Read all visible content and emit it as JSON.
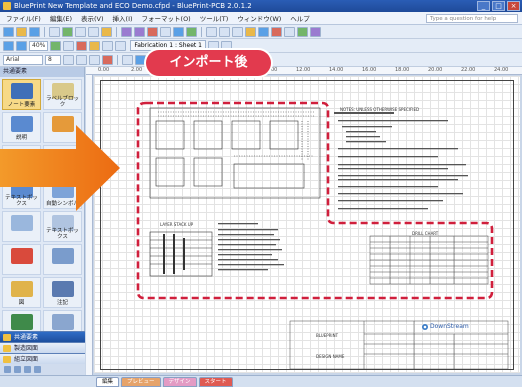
{
  "window": {
    "title": "BluePrint New Template and ECO Demo.cfpd - BluePrint-PCB 2.0.1.2"
  },
  "menu": {
    "items": [
      "ファイル(F)",
      "編集(E)",
      "表示(V)",
      "挿入(I)",
      "フォーマット(O)",
      "ツール(T)",
      "ウィンドウ(W)",
      "ヘルプ"
    ],
    "help_placeholder": "Type a question for help"
  },
  "toolbar": {
    "zoom_value": "40%",
    "font_value": "Arial",
    "size_value": "8",
    "tab_fabrication": "Fabrication 1 : Sheet 1"
  },
  "badge": {
    "label": "インポート後"
  },
  "left_panel": {
    "header": "共通要素",
    "items": [
      {
        "label": "ノート要素",
        "color": "#3f6fb8"
      },
      {
        "label": "ラベルブロック",
        "color": "#d9c98a"
      },
      {
        "label": "説明",
        "color": "#5a8ad0"
      },
      {
        "label": "",
        "color": "#e59a3a"
      },
      {
        "label": "",
        "color": "#6fa0d8"
      },
      {
        "label": "",
        "color": "#c07a3a"
      },
      {
        "label": "テキストボックス",
        "color": "#5a8ad0"
      },
      {
        "label": "自動シンボル",
        "color": "#7da3d8"
      },
      {
        "label": "",
        "color": "#9ab7dd"
      },
      {
        "label": "テキストボックス",
        "color": "#b0c4e0"
      },
      {
        "label": "",
        "color": "#d94a3c"
      },
      {
        "label": "",
        "color": "#7a9ccc"
      },
      {
        "label": "図",
        "color": "#e0b34a"
      },
      {
        "label": "注記",
        "color": "#5a7ab0"
      },
      {
        "label": "",
        "color": "#3f8a4a"
      },
      {
        "label": "詳細",
        "color": "#8aa6cf"
      },
      {
        "label": "拡大図",
        "color": "#e8c060"
      },
      {
        "label": "線",
        "color": "#d8b050"
      }
    ],
    "nav": [
      {
        "label": "共通要素",
        "active": true
      },
      {
        "label": "製造図面",
        "active": false
      },
      {
        "label": "組立図面",
        "active": false
      }
    ]
  },
  "ruler": {
    "labels": [
      "0.00",
      "2.00",
      "4.00",
      "6.00",
      "8.00",
      "10.00",
      "12.00",
      "14.00",
      "16.00",
      "18.00",
      "20.00",
      "22.00",
      "24.00"
    ]
  },
  "drawing": {
    "notes_title": "NOTES: UNLESS OTHERWISE SPECIFIED",
    "stackup_title": "LAYER STACK UP",
    "drill_title": "DRILL CHART",
    "company": "DownStream",
    "block_title": "BLUEPRINT",
    "block_sub": "DESIGN NAME"
  },
  "status_tabs": [
    {
      "label": "編集"
    },
    {
      "label": "プレビュー"
    },
    {
      "label": "デザイン"
    },
    {
      "label": "スタート"
    }
  ],
  "colors": {
    "accent_badge": "#e23a4e",
    "dashed_outline": "#d01f3c",
    "arrow": "#f0821c",
    "title_bar": "#2a5db5"
  }
}
